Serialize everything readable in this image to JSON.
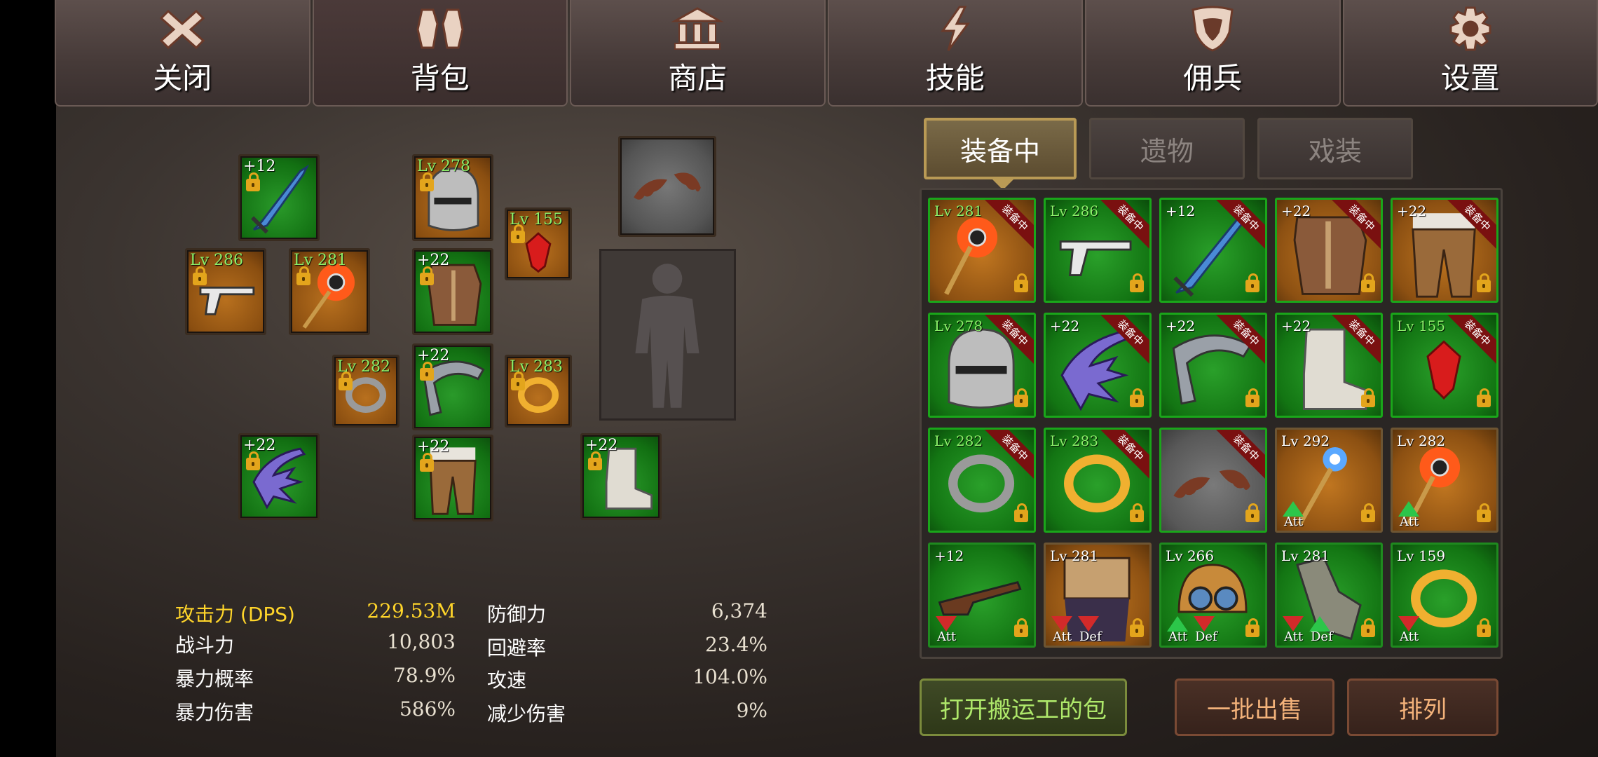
{
  "top_tabs": [
    {
      "label": "关闭",
      "icon": "close-icon"
    },
    {
      "label": "背包",
      "icon": "backpack-icon"
    },
    {
      "label": "商店",
      "icon": "shop-icon"
    },
    {
      "label": "技能",
      "icon": "skill-icon"
    },
    {
      "label": "佣兵",
      "icon": "mercenary-icon"
    },
    {
      "label": "设置",
      "icon": "gear-icon"
    }
  ],
  "active_top_tab": "背包",
  "equipment_slots": [
    {
      "id": "weapon",
      "tag": "+12",
      "item": "sword"
    },
    {
      "id": "helmet",
      "tag": "Lv 278",
      "item": "helmet"
    },
    {
      "id": "wings",
      "tag": "",
      "item": "bat-wings"
    },
    {
      "id": "pistol",
      "tag": "Lv 286",
      "item": "revolver"
    },
    {
      "id": "staff",
      "tag": "Lv 281",
      "item": "fire-staff"
    },
    {
      "id": "armor",
      "tag": "+22",
      "item": "armor"
    },
    {
      "id": "necklace",
      "tag": "Lv 155",
      "item": "red-gem"
    },
    {
      "id": "ring-left",
      "tag": "Lv 282",
      "item": "silver-ring"
    },
    {
      "id": "shoulder",
      "tag": "+22",
      "item": "shoulder"
    },
    {
      "id": "ring-right",
      "tag": "Lv 283",
      "item": "gold-ring"
    },
    {
      "id": "gloves",
      "tag": "+22",
      "item": "claw-gloves"
    },
    {
      "id": "pants",
      "tag": "+22",
      "item": "pants"
    },
    {
      "id": "boots",
      "tag": "+22",
      "item": "boots"
    }
  ],
  "stats": {
    "left": [
      {
        "label": "攻击力 (DPS)",
        "value": "229.53M"
      },
      {
        "label": "战斗力",
        "value": "10,803"
      },
      {
        "label": "暴力概率",
        "value": "78.9%"
      },
      {
        "label": "暴力伤害",
        "value": "586%"
      }
    ],
    "right": [
      {
        "label": "防御力",
        "value": "6,374"
      },
      {
        "label": "回避率",
        "value": "23.4%"
      },
      {
        "label": "攻速",
        "value": "104.0%"
      },
      {
        "label": "减少伤害",
        "value": "9%"
      }
    ]
  },
  "inventory_tabs": [
    {
      "label": "装备中",
      "active": true
    },
    {
      "label": "遗物",
      "active": false
    },
    {
      "label": "戏装",
      "active": false
    }
  ],
  "equipped_ribbon": "装备中",
  "inventory": [
    {
      "tag": "Lv 281",
      "item": "fire-staff",
      "equipped": true,
      "bg": "o"
    },
    {
      "tag": "Lv 286",
      "item": "revolver",
      "equipped": true,
      "bg": "g"
    },
    {
      "tag": "+12",
      "item": "sword",
      "equipped": true,
      "bg": "g"
    },
    {
      "tag": "+22",
      "item": "armor",
      "equipped": true,
      "bg": "o"
    },
    {
      "tag": "+22",
      "item": "pants",
      "equipped": true,
      "bg": "o"
    },
    {
      "tag": "Lv 278",
      "item": "helmet",
      "equipped": true,
      "bg": "g"
    },
    {
      "tag": "+22",
      "item": "claw-gloves",
      "equipped": true,
      "bg": "g"
    },
    {
      "tag": "+22",
      "item": "shoulder",
      "equipped": true,
      "bg": "g"
    },
    {
      "tag": "+22",
      "item": "boots",
      "equipped": true,
      "bg": "g"
    },
    {
      "tag": "Lv 155",
      "item": "red-gem",
      "equipped": true,
      "bg": "g"
    },
    {
      "tag": "Lv 282",
      "item": "silver-ring",
      "equipped": true,
      "bg": "g"
    },
    {
      "tag": "Lv 283",
      "item": "gold-ring",
      "equipped": true,
      "bg": "g"
    },
    {
      "tag": "",
      "item": "bat-wings",
      "equipped": true,
      "bg": "gr"
    },
    {
      "tag": "Lv 292",
      "item": "blue-staff",
      "equipped": false,
      "bg": "o",
      "arrows": [
        {
          "dir": "up",
          "label": "Att"
        }
      ]
    },
    {
      "tag": "Lv 282",
      "item": "fire-staff",
      "equipped": false,
      "bg": "o",
      "arrows": [
        {
          "dir": "up",
          "label": "Att"
        }
      ]
    },
    {
      "tag": "+12",
      "item": "rifle",
      "equipped": false,
      "bg": "g",
      "arrows": [
        {
          "dir": "down",
          "label": "Att"
        }
      ]
    },
    {
      "tag": "Lv 281",
      "item": "chest-armor",
      "equipped": false,
      "bg": "o",
      "arrows": [
        {
          "dir": "down",
          "label": "Att"
        },
        {
          "dir": "down",
          "label": "Def"
        }
      ]
    },
    {
      "tag": "Lv 266",
      "item": "goggle-helmet",
      "equipped": false,
      "bg": "g",
      "arrows": [
        {
          "dir": "up",
          "label": "Att"
        },
        {
          "dir": "down",
          "label": "Def"
        }
      ]
    },
    {
      "tag": "Lv 281",
      "item": "gauntlet",
      "equipped": false,
      "bg": "g",
      "arrows": [
        {
          "dir": "down",
          "label": "Att"
        },
        {
          "dir": "up",
          "label": "Def"
        }
      ]
    },
    {
      "tag": "Lv 159",
      "item": "gold-ring",
      "equipped": false,
      "bg": "g",
      "arrows": [
        {
          "dir": "down",
          "label": "Att"
        }
      ]
    }
  ],
  "buttons": {
    "open_porter_bag": "打开搬运工的包",
    "bulk_sell": "一批出售",
    "sort": "排列"
  },
  "colors": {
    "level_text": "#8cf06a",
    "dps_highlight": "#ffd52a",
    "rarity_green": "#137513",
    "rarity_orange": "#8c5012",
    "equipped_ribbon": "#7a1010"
  }
}
